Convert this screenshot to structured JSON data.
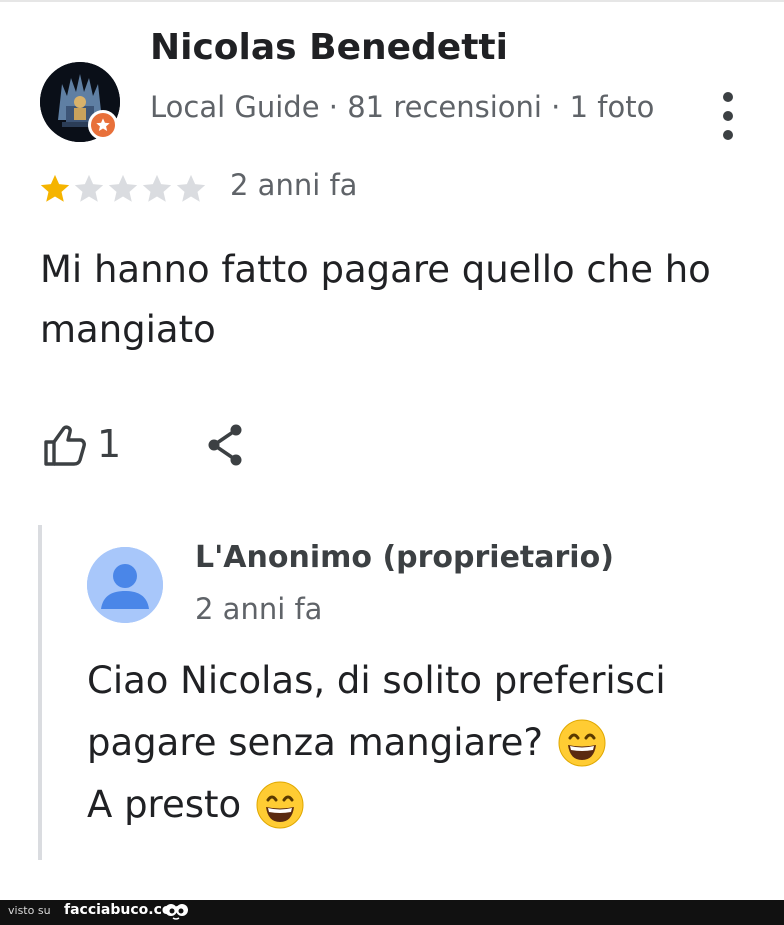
{
  "review": {
    "author_name": "Nicolas Benedetti",
    "author_meta": "Local Guide · 81 recensioni · 1 foto",
    "rating": 1,
    "rating_max": 5,
    "time": "2 anni fa",
    "text": "Mi hanno fatto pagare quello che ho mangiato",
    "likes": "1"
  },
  "owner_reply": {
    "name": "L'Anonimo (proprietario)",
    "time": "2 anni fa",
    "line1": "Ciao Nicolas, di solito preferisci",
    "line2": "pagare senza mangiare?",
    "line3": "A presto"
  },
  "footer": {
    "visto_su": "visto su",
    "site": "facciabuco.com"
  },
  "icons": {
    "more": "more-vert-icon",
    "like": "thumbs-up-icon",
    "share": "share-icon",
    "emoji": "grinning-face-emoji-icon",
    "star": "star-icon"
  },
  "colors": {
    "star_filled": "#f5b400",
    "star_empty": "#dadce0",
    "badge": "#e8703a",
    "owner_avatar_bg": "#a8c7fa",
    "owner_avatar_fg": "#4a86e8"
  }
}
